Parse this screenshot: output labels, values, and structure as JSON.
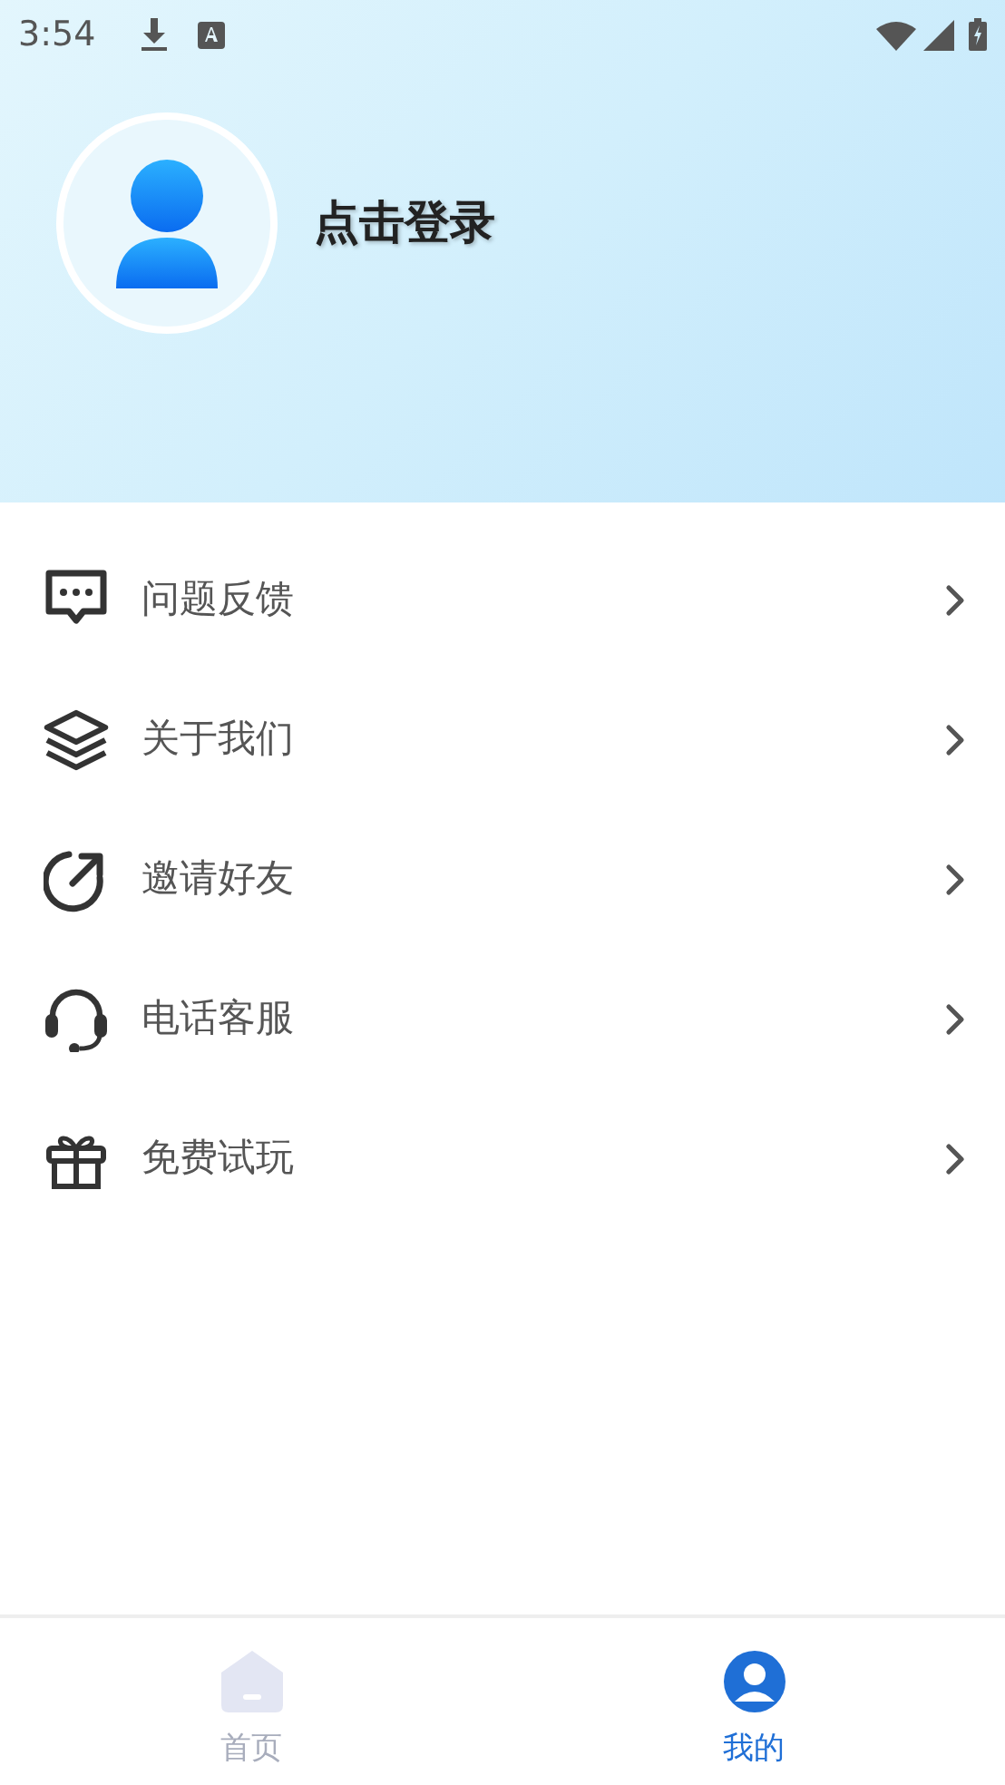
{
  "status_bar": {
    "time": "3:54"
  },
  "profile": {
    "login_label": "点击登录"
  },
  "menu": [
    {
      "kind": "feedback",
      "label": "问题反馈"
    },
    {
      "kind": "about",
      "label": "关于我们"
    },
    {
      "kind": "invite",
      "label": "邀请好友"
    },
    {
      "kind": "support",
      "label": "电话客服"
    },
    {
      "kind": "trial",
      "label": "免费试玩"
    }
  ],
  "bottom_nav": [
    {
      "kind": "home",
      "label": "首页",
      "selected": false
    },
    {
      "kind": "mine",
      "label": "我的",
      "selected": true
    }
  ]
}
